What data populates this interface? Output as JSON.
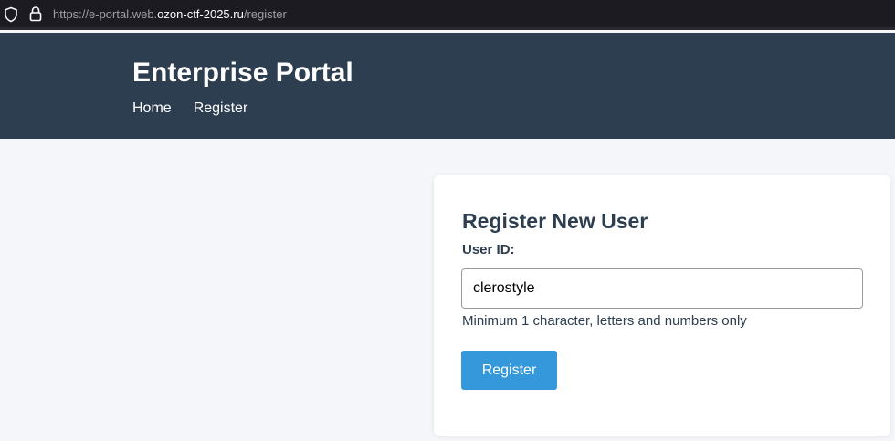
{
  "browser": {
    "url_prefix": "https://e-portal.web.",
    "url_domain": "ozon-ctf-2025.ru",
    "url_path": "/register",
    "shield_icon": "shield-icon",
    "lock_icon": "lock-icon"
  },
  "header": {
    "title": "Enterprise Portal",
    "nav": [
      {
        "label": "Home"
      },
      {
        "label": "Register"
      }
    ],
    "background_color": "#2c3e50"
  },
  "register_form": {
    "title": "Register New User",
    "user_id_label": "User ID:",
    "user_id_value": "clerostyle",
    "hint": "Minimum 1 character, letters and numbers only",
    "submit_label": "Register",
    "button_color": "#3498db"
  }
}
